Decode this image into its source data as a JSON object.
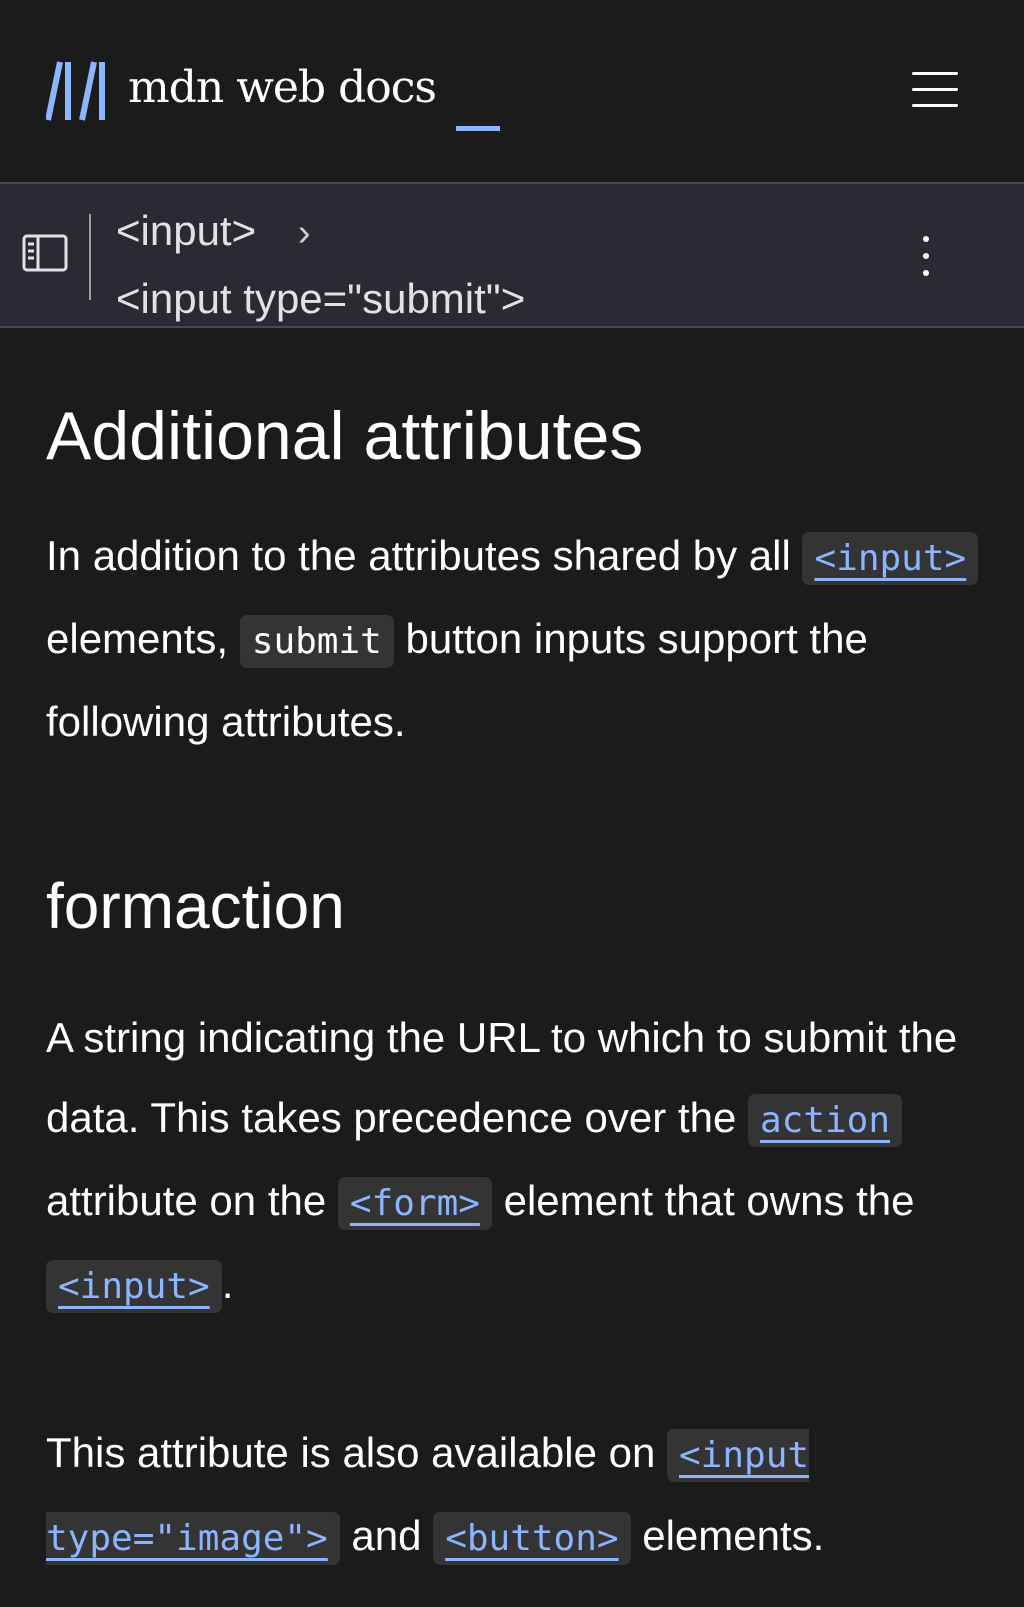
{
  "header": {
    "logo_text": "mdn web docs",
    "logo_accent_color": "#8cb4ff",
    "menu_icon": "hamburger-menu-icon"
  },
  "breadcrumb": {
    "sidebar_icon": "sidebar-toggle-icon",
    "items": [
      "<input>",
      "<input type=\"submit\">"
    ],
    "separator_icon": "chevron-right-icon",
    "more_icon": "vertical-ellipsis-icon"
  },
  "content": {
    "section_title": "Additional attributes",
    "intro": {
      "t1": "In addition to the attributes shared by all ",
      "code1": "<input>",
      "t2": " elements, ",
      "code2": "submit",
      "t3": " button inputs support the following attributes."
    },
    "attribute_name": "formaction",
    "desc": {
      "t1": "A string indicating the URL to which to submit the data. This takes precedence over the ",
      "code1": "action",
      "t2": " attribute on the ",
      "code2": "<form>",
      "t3": " element that owns the ",
      "code3": "<input>",
      "t4": "."
    },
    "note": {
      "t1": "This attribute is also available on ",
      "code1": "<input type=\"image\">",
      "t2": " and ",
      "code2": "<button>",
      "t3": " elements."
    }
  },
  "colors": {
    "background": "#1b1b1b",
    "breadcrumb_bar": "#2b2a33",
    "link": "#8cb4ff",
    "code_background": "#343434"
  }
}
